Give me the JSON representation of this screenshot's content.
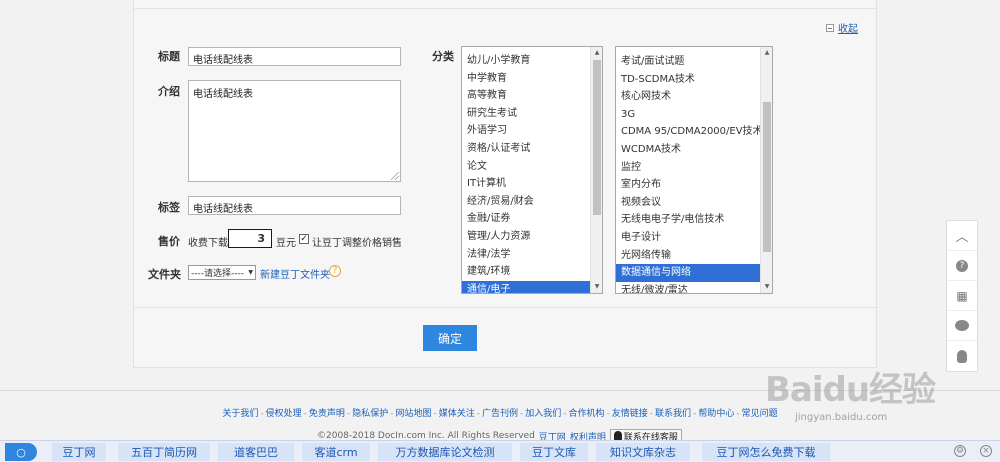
{
  "form": {
    "collapse_label": "收起",
    "title_label": "标题",
    "title_value": "电话线配线表",
    "intro_label": "介绍",
    "intro_value": "电话线配线表",
    "tags_label": "标签",
    "tags_value": "电话线配线表",
    "price_label": "售价",
    "price_prefix": "收费下载",
    "price_value": "3",
    "price_unit": "豆元",
    "price_allow_label": "让豆丁调整价格销售",
    "price_allow_checked": true,
    "folder_label": "文件夹",
    "folder_select": "----请选择----",
    "new_folder_label": "新建豆丁文件夹",
    "category_label": "分类",
    "confirm_label": "确定"
  },
  "category_primary": [
    "幼儿/小学教育",
    "中学教育",
    "高等教育",
    "研究生考试",
    "外语学习",
    "资格/认证考试",
    "论文",
    "IT计算机",
    "经济/贸易/财会",
    "金融/证券",
    "管理/人力资源",
    "法律/法学",
    "建筑/环境",
    "通信/电子"
  ],
  "category_primary_selected": "通信/电子",
  "category_secondary": [
    "考试/面试试题",
    "TD-SCDMA技术",
    "核心网技术",
    "3G",
    "CDMA 95/CDMA2000/EV技术",
    "WCDMA技术",
    "监控",
    "室内分布",
    "视频会议",
    "无线电电子学/电信技术",
    "电子设计",
    "光网络传输",
    "数据通信与网络",
    "无线/微波/雷达"
  ],
  "category_secondary_selected": "数据通信与网络",
  "sidebar": [
    "up-arrow-icon",
    "help-icon",
    "qrcode-icon",
    "wechat-icon",
    "qq-icon"
  ],
  "footer": {
    "links": [
      "关于我们",
      "侵权处理",
      "免责声明",
      "隐私保护",
      "网站地图",
      "媒体关注",
      "广告刊例",
      "加入我们",
      "合作机构",
      "友情链接",
      "联系我们",
      "帮助中心",
      "常见问题"
    ],
    "copyright": "©2008-2018 DocIn.com Inc. All Rights Reserved",
    "brand": "豆丁网",
    "rights": "权利声明",
    "service": "联系在线客服"
  },
  "watermark": {
    "text": "Baidu经验",
    "url": "jingyan.baidu.com"
  },
  "bottombar": {
    "items": [
      "豆丁网",
      "五百丁简历网",
      "道客巴巴",
      "客道crm",
      "万方数据库论文检测",
      "豆丁文库",
      "知识文库杂志",
      "豆丁网怎么免费下载"
    ]
  }
}
